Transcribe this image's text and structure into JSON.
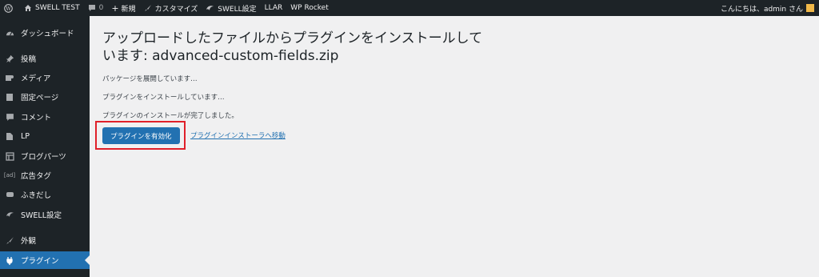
{
  "adminbar": {
    "site_name": "SWELL TEST",
    "comments_count": "0",
    "new_label": "新規",
    "customize_label": "カスタマイズ",
    "swell_settings_label": "SWELL設定",
    "llar_label": "LLAR",
    "wprocket_label": "WP Rocket",
    "greeting": "こんにちは、admin さん"
  },
  "sidebar": {
    "items": [
      {
        "label": "ダッシュボード",
        "icon": "dashboard-icon"
      },
      {
        "label": "投稿",
        "icon": "pin-icon"
      },
      {
        "label": "メディア",
        "icon": "media-icon"
      },
      {
        "label": "固定ページ",
        "icon": "page-icon"
      },
      {
        "label": "コメント",
        "icon": "comment-icon"
      },
      {
        "label": "LP",
        "icon": "document-icon"
      },
      {
        "label": "ブログパーツ",
        "icon": "blocks-icon"
      },
      {
        "label": "広告タグ",
        "icon": "ad-icon"
      },
      {
        "label": "ふきだし",
        "icon": "bubble-icon"
      },
      {
        "label": "SWELL設定",
        "icon": "swell-icon"
      },
      {
        "label": "外観",
        "icon": "brush-icon"
      },
      {
        "label": "プラグイン",
        "icon": "plugin-icon"
      }
    ],
    "ad_icon_text": "[ad]"
  },
  "main": {
    "title": "アップロードしたファイルからプラグインをインストールしています: advanced-custom-fields.zip",
    "messages": [
      "パッケージを展開しています…",
      "プラグインをインストールしています…",
      "プラグインのインストールが完了しました。"
    ],
    "activate_button": "プラグインを有効化",
    "installer_link": "プラグインインストーラへ移動"
  },
  "colors": {
    "accent": "#2271b1",
    "sidebar_bg": "#1d2327",
    "highlight": "#e0202a"
  }
}
